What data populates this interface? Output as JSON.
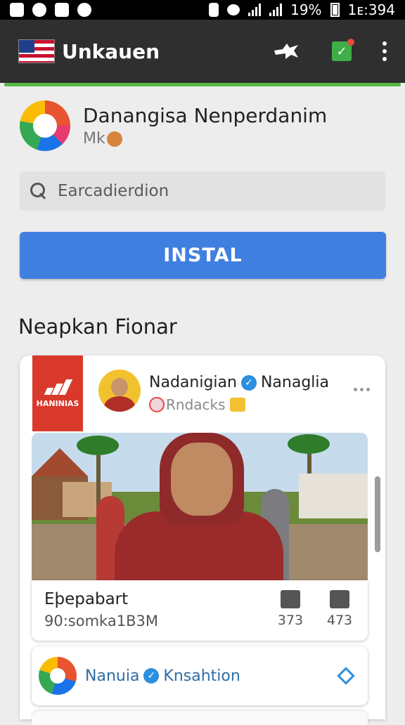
{
  "status_bar": {
    "battery": "19%",
    "time": "1ᴇ:394"
  },
  "app_bar": {
    "title": "Unkauen"
  },
  "app": {
    "name": "Danangisa Nenperdanim",
    "sub": "Mk"
  },
  "search": {
    "placeholder": "Earcadierdion"
  },
  "install": {
    "label": "INSTAL"
  },
  "section": {
    "title": "Neapkan Fionar"
  },
  "post": {
    "brand": "HANINIAS",
    "author_a": "Nadanigian",
    "author_b": "Nanaglia",
    "sub": "Rndacks",
    "title": "Eþepabart",
    "subtitle": "90:somka1B3M",
    "stat_shares": "373",
    "stat_saves": "473"
  },
  "related": {
    "name_a": "Nanuia",
    "name_b": "Knsahtion"
  },
  "colors": {
    "install_blue": "#3f7fe0",
    "progress_green": "#57b846",
    "app_bar": "#2f2f2f"
  }
}
